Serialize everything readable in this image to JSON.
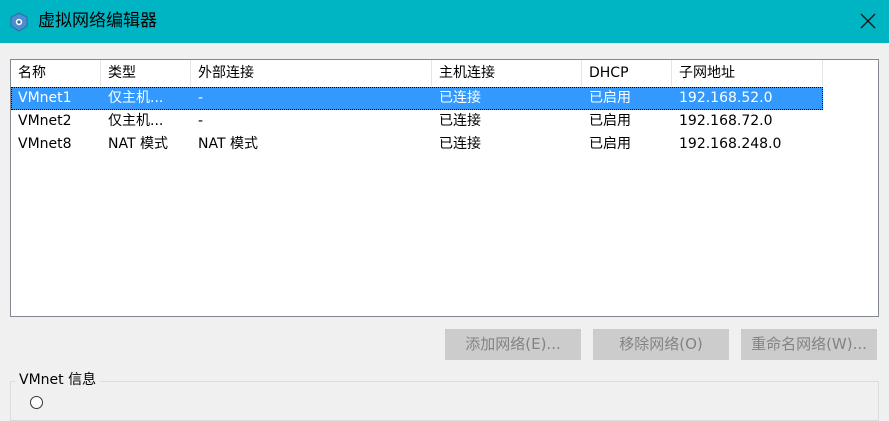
{
  "window": {
    "title": "虚拟网络编辑器",
    "app_icon": "vmware-network-icon",
    "close_icon": "close-icon"
  },
  "table": {
    "columns": [
      "名称",
      "类型",
      "外部连接",
      "主机连接",
      "DHCP",
      "子网地址"
    ],
    "rows": [
      {
        "name": "VMnet1",
        "type": "仅主机...",
        "external": "-",
        "host": "已连接",
        "dhcp": "已启用",
        "subnet": "192.168.52.0",
        "selected": true
      },
      {
        "name": "VMnet2",
        "type": "仅主机...",
        "external": "-",
        "host": "已连接",
        "dhcp": "已启用",
        "subnet": "192.168.72.0",
        "selected": false
      },
      {
        "name": "VMnet8",
        "type": "NAT 模式",
        "external": "NAT 模式",
        "host": "已连接",
        "dhcp": "已启用",
        "subnet": "192.168.248.0",
        "selected": false
      }
    ]
  },
  "buttons": {
    "add_network": "添加网络(E)...",
    "remove_network": "移除网络(O)",
    "rename_network": "重命名网络(W)..."
  },
  "info_group": {
    "label": "VMnet 信息"
  },
  "colors": {
    "titlebar": "#00b5c3",
    "selection": "#3399ff",
    "disabled_button_bg": "#cccccc",
    "disabled_button_text": "#838383"
  }
}
